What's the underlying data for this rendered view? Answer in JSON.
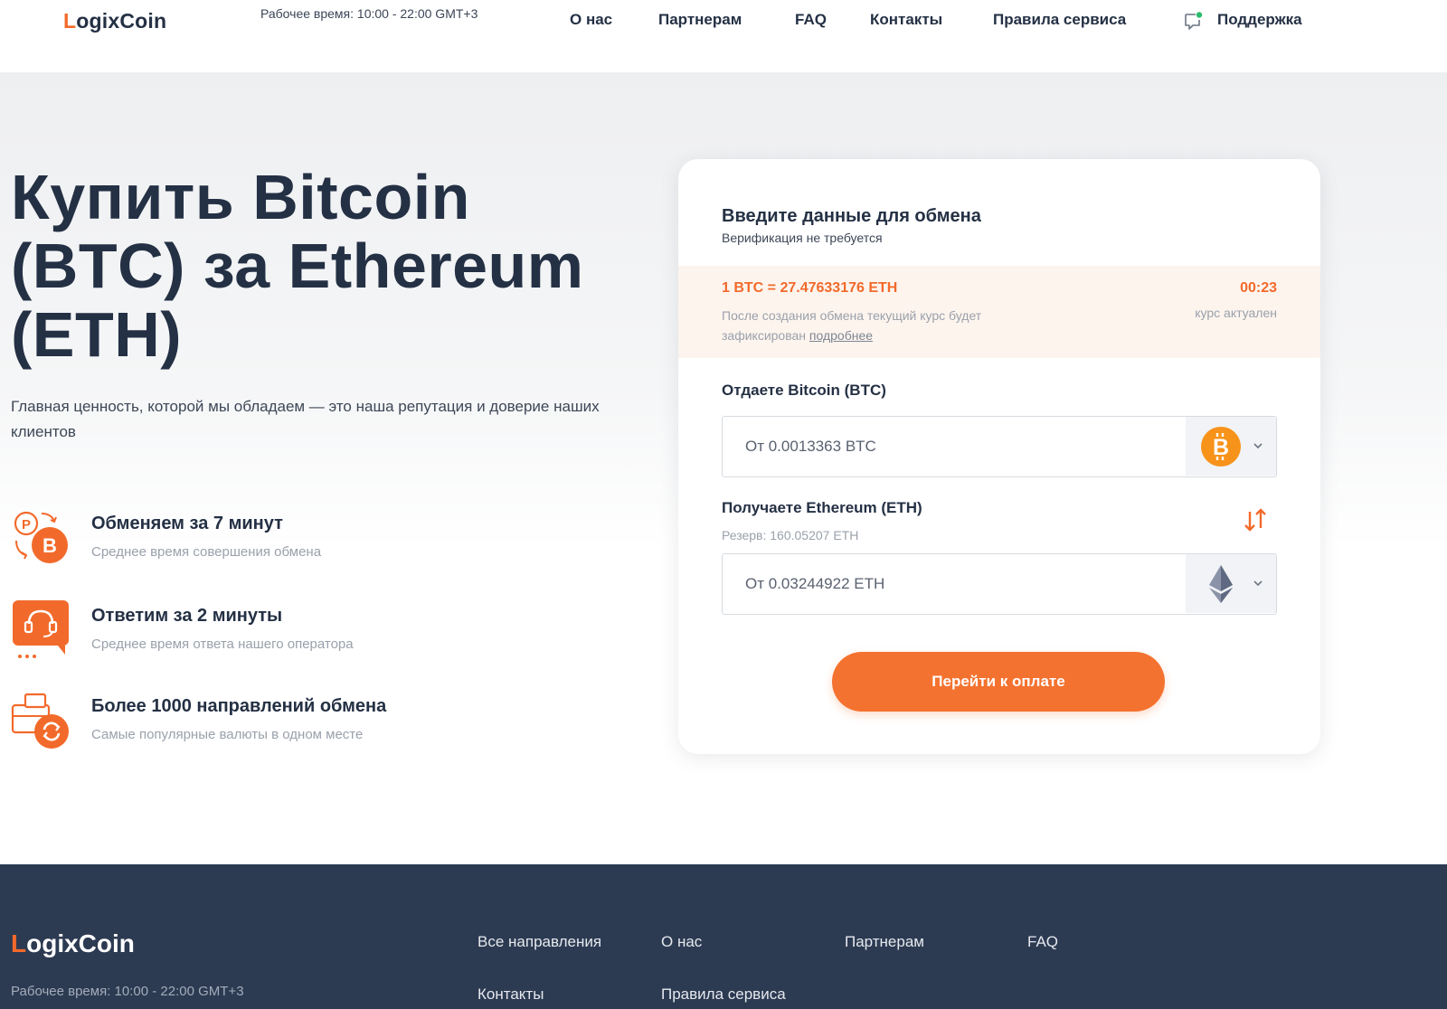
{
  "header": {
    "logo_first": "L",
    "logo_rest": "ogixCoin",
    "work_hours": "Рабочее время: 10:00 - 22:00 GMT+3",
    "nav": [
      "О нас",
      "Партнерам",
      "FAQ",
      "Контакты",
      "Правила сервиса",
      "Поддержка"
    ]
  },
  "hero": {
    "title": "Купить Bitcoin (BTC) за Ethereum (ETH)",
    "subtitle": "Главная ценность, которой мы обладаем — это наша репутация и доверие наших клиентов",
    "features": [
      {
        "title": "Обменяем за 7 минут",
        "desc": "Среднее время совершения обмена",
        "icon": "exchange-bitcoin-icon"
      },
      {
        "title": "Ответим за 2 минуты",
        "desc": "Среднее время ответа нашего оператора",
        "icon": "support-operator-icon"
      },
      {
        "title": "Более 1000 направлений обмена",
        "desc": "Самые популярные валюты в одном месте",
        "icon": "wallet-exchange-icon"
      }
    ]
  },
  "exchange": {
    "title": "Введите данные для обмена",
    "subtitle": "Верификация не требуется",
    "rate": "1 BTC = 27.47633176 ETH",
    "rate_note": "После создания обмена текущий курс будет зафиксирован",
    "rate_link": "подробнее",
    "timer": "00:23",
    "timer_note": "курс актуален",
    "give_label": "Отдаете Bitcoin (BTC)",
    "give_placeholder": "От 0.0013363 BTC",
    "get_label": "Получаете Ethereum (ETH)",
    "reserve": "Резерв: 160.05207 ETH",
    "get_placeholder": "От 0.03244922 ETH",
    "button": "Перейти к оплате"
  },
  "footer": {
    "logo_first": "L",
    "logo_rest": "ogixCoin",
    "work_hours": "Рабочее время: 10:00 - 22:00 GMT+3",
    "links": [
      "Все направления",
      "О нас",
      "Партнерам",
      "FAQ",
      "Контакты",
      "Правила сервиса"
    ]
  },
  "colors": {
    "accent": "#f26a2b",
    "dark": "#243044",
    "footer": "#2c3a52",
    "bitcoin": "#f7931a"
  }
}
